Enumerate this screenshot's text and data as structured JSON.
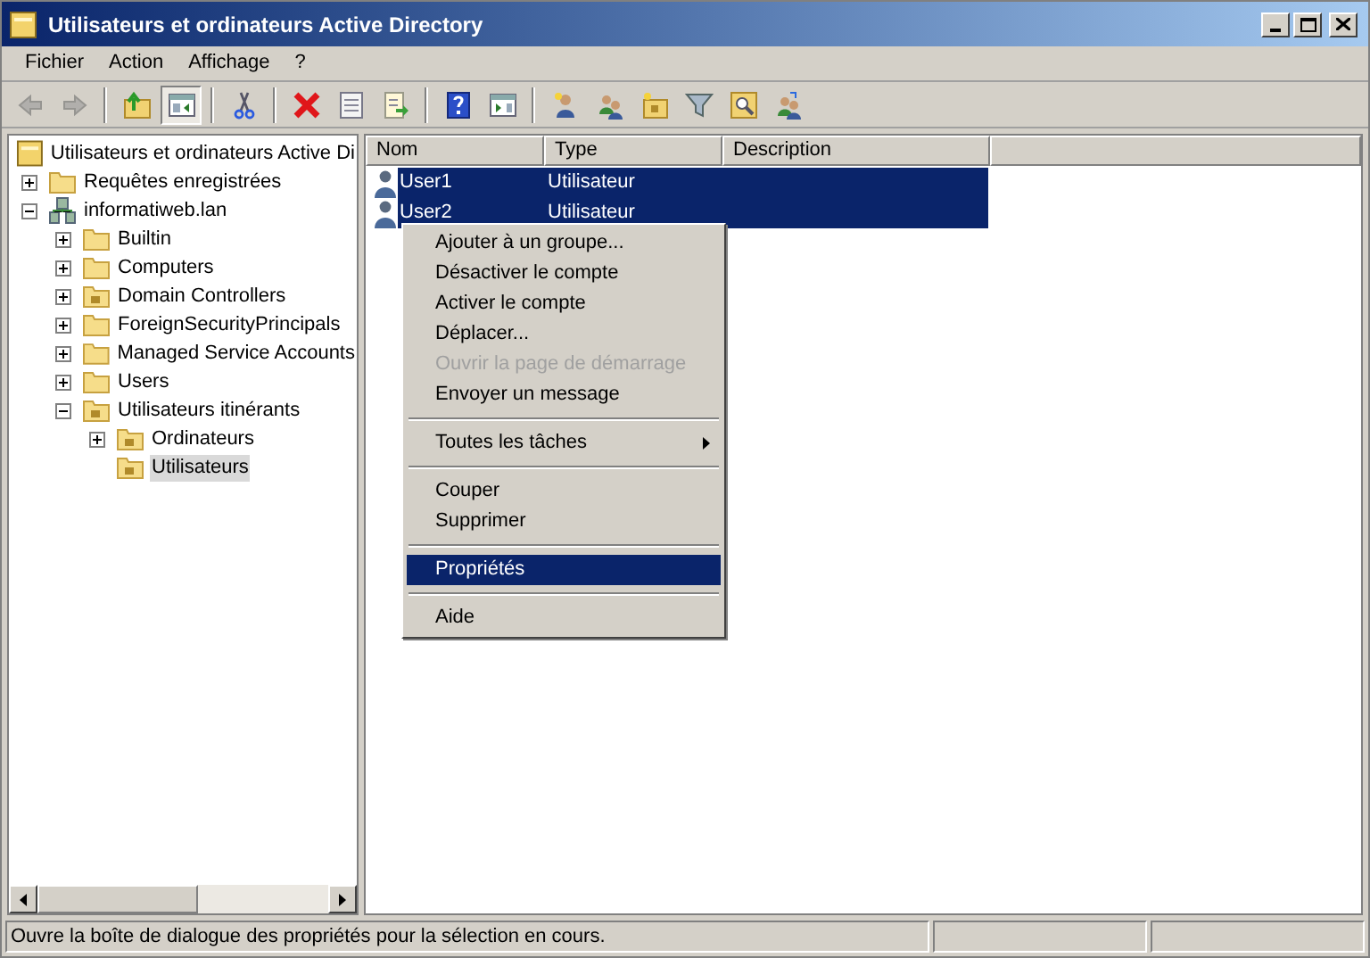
{
  "window": {
    "title": "Utilisateurs et ordinateurs Active Directory"
  },
  "menu_bar": [
    "Fichier",
    "Action",
    "Affichage",
    "?"
  ],
  "toolbar": [
    {
      "kind": "back",
      "disabled": true,
      "pressed": false
    },
    {
      "kind": "forward",
      "disabled": true,
      "pressed": false
    },
    {
      "kind": "separator"
    },
    {
      "kind": "up",
      "disabled": false,
      "pressed": false
    },
    {
      "kind": "console-tree",
      "disabled": false,
      "pressed": true
    },
    {
      "kind": "separator"
    },
    {
      "kind": "cut",
      "disabled": false,
      "pressed": false
    },
    {
      "kind": "separator"
    },
    {
      "kind": "delete",
      "disabled": false,
      "pressed": false
    },
    {
      "kind": "properties",
      "disabled": false,
      "pressed": false
    },
    {
      "kind": "export",
      "disabled": false,
      "pressed": false
    },
    {
      "kind": "separator"
    },
    {
      "kind": "help",
      "disabled": false,
      "pressed": false
    },
    {
      "kind": "action-pane",
      "disabled": false,
      "pressed": false
    },
    {
      "kind": "separator"
    },
    {
      "kind": "new-user",
      "disabled": false,
      "pressed": false
    },
    {
      "kind": "new-group",
      "disabled": false,
      "pressed": false
    },
    {
      "kind": "new-ou",
      "disabled": false,
      "pressed": false
    },
    {
      "kind": "filter",
      "disabled": false,
      "pressed": false
    },
    {
      "kind": "find",
      "disabled": false,
      "pressed": false
    },
    {
      "kind": "add-to-group",
      "disabled": false,
      "pressed": false
    }
  ],
  "tree": {
    "label": "Utilisateurs et ordinateurs Active Di",
    "kind": "root",
    "selected": false,
    "children": [
      {
        "label": "Requêtes enregistrées",
        "kind": "folder",
        "expanded": false,
        "selected": false
      },
      {
        "label": "informatiweb.lan",
        "kind": "domain",
        "expanded": true,
        "selected": false,
        "children": [
          {
            "label": "Builtin",
            "kind": "folder",
            "expanded": false,
            "selected": false
          },
          {
            "label": "Computers",
            "kind": "folder",
            "expanded": false,
            "selected": false
          },
          {
            "label": "Domain Controllers",
            "kind": "ou",
            "expanded": false,
            "selected": false
          },
          {
            "label": "ForeignSecurityPrincipals",
            "kind": "folder",
            "expanded": false,
            "selected": false
          },
          {
            "label": "Managed Service Accounts",
            "kind": "folder",
            "expanded": false,
            "selected": false
          },
          {
            "label": "Users",
            "kind": "folder",
            "expanded": false,
            "selected": false
          },
          {
            "label": "Utilisateurs itinérants",
            "kind": "ou",
            "expanded": true,
            "selected": false,
            "children": [
              {
                "label": "Ordinateurs",
                "kind": "ou",
                "expanded": false,
                "selected": false
              },
              {
                "label": "Utilisateurs",
                "kind": "ou",
                "selected": true
              }
            ]
          }
        ]
      }
    ]
  },
  "table": {
    "columns": [
      "Nom",
      "Type",
      "Description"
    ],
    "rows": [
      {
        "name": "User1",
        "type": "Utilisateur",
        "selected": true
      },
      {
        "name": "User2",
        "type": "Utilisateur",
        "selected": true
      }
    ]
  },
  "context_menu": [
    {
      "kind": "item",
      "label": "Ajouter à un groupe...",
      "disabled": false,
      "selected": false
    },
    {
      "kind": "item",
      "label": "Désactiver le compte",
      "disabled": false,
      "selected": false
    },
    {
      "kind": "item",
      "label": "Activer le compte",
      "disabled": false,
      "selected": false
    },
    {
      "kind": "item",
      "label": "Déplacer...",
      "disabled": false,
      "selected": false
    },
    {
      "kind": "item",
      "label": "Ouvrir la page de démarrage",
      "disabled": true,
      "selected": false
    },
    {
      "kind": "item",
      "label": "Envoyer un message",
      "disabled": false,
      "selected": false
    },
    {
      "kind": "separator"
    },
    {
      "kind": "submenu",
      "label": "Toutes les tâches",
      "disabled": false,
      "selected": false
    },
    {
      "kind": "separator"
    },
    {
      "kind": "item",
      "label": "Couper",
      "disabled": false,
      "selected": false
    },
    {
      "kind": "item",
      "label": "Supprimer",
      "disabled": false,
      "selected": false
    },
    {
      "kind": "separator"
    },
    {
      "kind": "item",
      "label": "Propriétés",
      "disabled": false,
      "selected": true
    },
    {
      "kind": "separator"
    },
    {
      "kind": "item",
      "label": "Aide",
      "disabled": false,
      "selected": false
    }
  ],
  "status_bar": "Ouvre la boîte de dialogue des propriétés pour la sélection en cours."
}
